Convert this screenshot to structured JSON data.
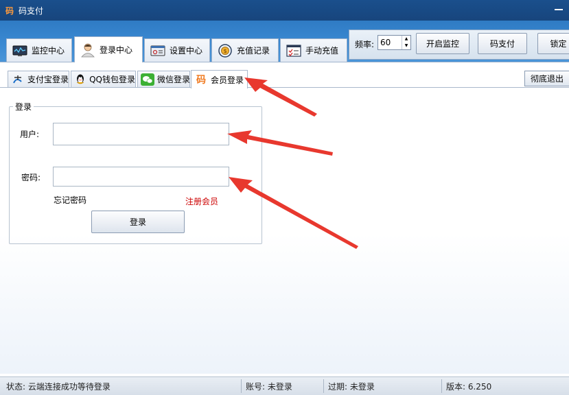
{
  "window": {
    "logo": "码",
    "title": "码支付"
  },
  "main_tabs": [
    {
      "label": "监控中心",
      "icon": "monitor-icon"
    },
    {
      "label": "登录中心",
      "icon": "user-icon"
    },
    {
      "label": "设置中心",
      "icon": "settings-icon"
    },
    {
      "label": "充值记录",
      "icon": "coin-icon"
    },
    {
      "label": "手动充值",
      "icon": "checklist-icon"
    }
  ],
  "toolbar": {
    "freq_label": "频率:",
    "freq_value": "60",
    "start_monitor": "开启监控",
    "code_pay": "码支付",
    "lock": "锁定"
  },
  "sub_tabs": [
    {
      "label": "支付宝登录",
      "icon": "alipay-icon"
    },
    {
      "label": "QQ钱包登录",
      "icon": "qq-icon"
    },
    {
      "label": "微信登录",
      "icon": "wechat-icon"
    },
    {
      "label": "会员登录",
      "icon": "member-code-icon",
      "glyph": "码"
    }
  ],
  "exit_button": "彻底退出",
  "login": {
    "group_title": "登录",
    "user_label": "用户:",
    "user_value": "",
    "password_label": "密码:",
    "password_value": "",
    "forgot": "忘记密码",
    "register": "注册会员",
    "submit": "登录"
  },
  "status": {
    "state": "状态: 云端连接成功等待登录",
    "account": "账号: 未登录",
    "expiry": "过期: 未登录",
    "version": "版本: 6.250"
  },
  "colors": {
    "accent_blue": "#2f7bc4",
    "register_red": "#cc0000",
    "arrow_red": "#e8382e"
  }
}
